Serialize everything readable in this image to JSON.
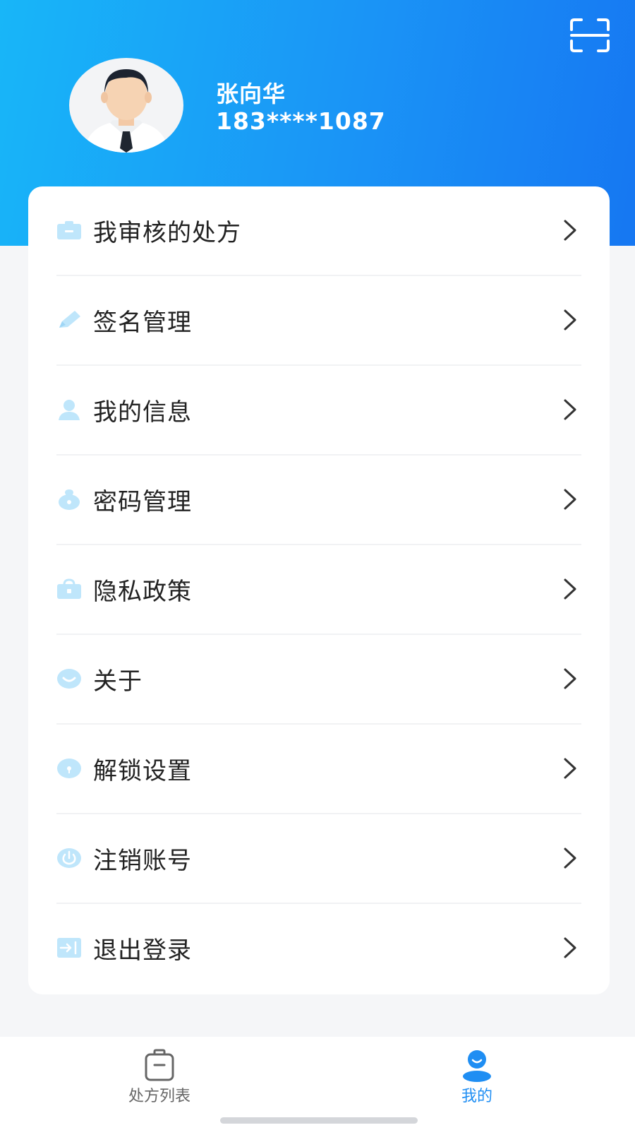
{
  "profile": {
    "name": "张向华",
    "phone": "183****1087"
  },
  "header": {
    "scan_icon": "scan-icon"
  },
  "menu": {
    "items": [
      {
        "label": "我审核的处方",
        "icon": "prescription-folder-icon"
      },
      {
        "label": "签名管理",
        "icon": "pencil-icon"
      },
      {
        "label": "我的信息",
        "icon": "user-icon"
      },
      {
        "label": "密码管理",
        "icon": "password-lock-icon"
      },
      {
        "label": "隐私政策",
        "icon": "privacy-bag-icon"
      },
      {
        "label": "关于",
        "icon": "smile-icon"
      },
      {
        "label": "解锁设置",
        "icon": "unlock-icon"
      },
      {
        "label": "注销账号",
        "icon": "power-icon"
      },
      {
        "label": "退出登录",
        "icon": "logout-icon"
      }
    ]
  },
  "tabbar": {
    "tabs": [
      {
        "label": "处方列表",
        "icon": "clipboard-icon",
        "active": false
      },
      {
        "label": "我的",
        "icon": "profile-icon",
        "active": true
      }
    ]
  },
  "colors": {
    "header_gradient_start": "#18b6f8",
    "header_gradient_end": "#1677f2",
    "icon_light_blue": "#bfe6fb",
    "active_tab": "#1f8ef3",
    "inactive_tab": "#666666"
  }
}
